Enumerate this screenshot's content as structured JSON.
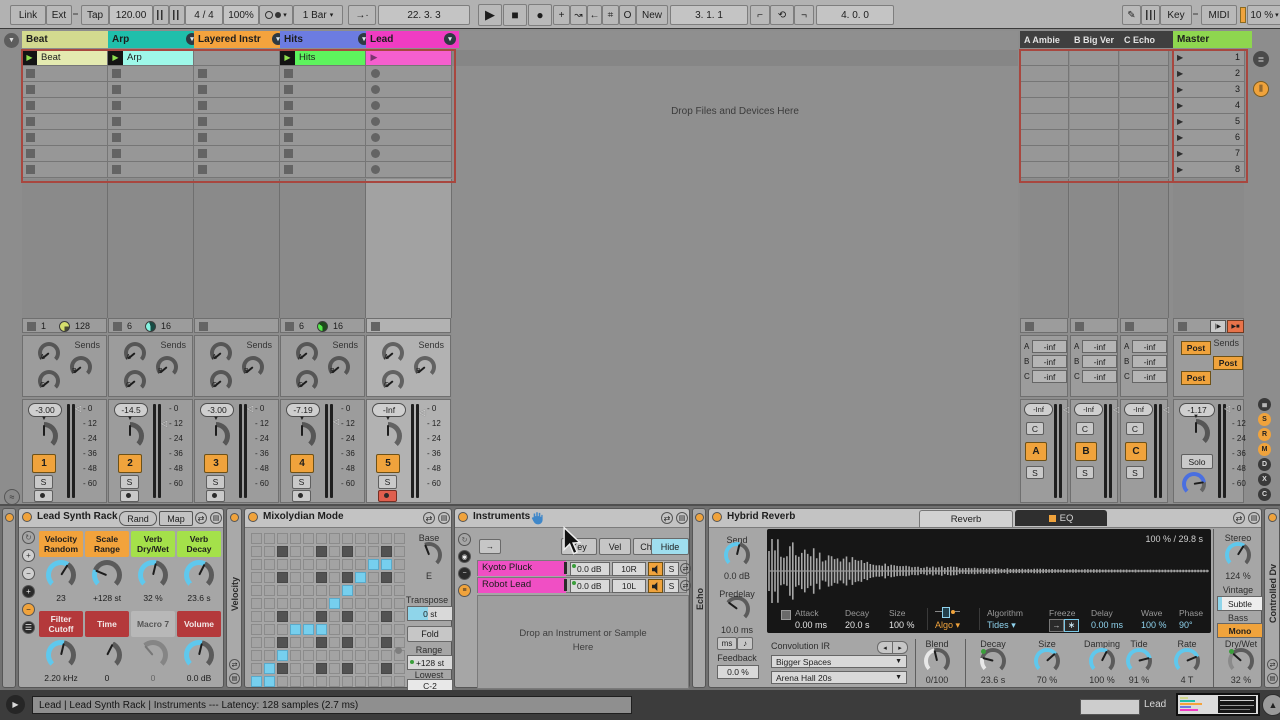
{
  "toolbar": {
    "link": "Link",
    "ext": "Ext",
    "tap": "Tap",
    "tempo": "120.00",
    "sig": "4 / 4",
    "quantize": "100%",
    "groove_menu": "1 Bar",
    "arrangement_pos": "22. 3. 3",
    "new_button": "New",
    "loop_start": "3. 1. 1",
    "loop_length": "4. 0. 0",
    "key": "Key",
    "midi": "MIDI",
    "cpu": "10 %"
  },
  "session": {
    "drop_hint": "Drop Files and Devices Here",
    "scene_numbers": [
      "1",
      "2",
      "3",
      "4",
      "5",
      "6",
      "7",
      "8"
    ],
    "tracks": [
      {
        "name": "Beat",
        "color": "#d3da8f",
        "clip": "Beat",
        "clip_color": "#e4eab0",
        "dd": false,
        "stat1": "1",
        "stat2": "128",
        "pie": [
          "#d6de6d",
          "#4a4a35",
          0.75
        ],
        "vol": "-3.00",
        "num": "1",
        "fader": 0.03,
        "armed": false
      },
      {
        "name": "Arp",
        "color": "#1fbfab",
        "clip": "Arp",
        "clip_color": "#9ef8e9",
        "dd": true,
        "stat1": "6",
        "stat2": "16",
        "pie": [
          "#86f4e2",
          "#174b44",
          0.45
        ],
        "vol": "-14.5",
        "num": "2",
        "fader": 0.2,
        "armed": false
      },
      {
        "name": "Layered Instr",
        "color": "#f4a33d",
        "clip": null,
        "dd": true,
        "stat1": "",
        "stat2": "",
        "pie": null,
        "vol": "-3.00",
        "num": "3",
        "fader": 0.03,
        "armed": false
      },
      {
        "name": "Hits",
        "color": "#6c7ce1",
        "clip": "Hits",
        "clip_color": "#5df35d",
        "dd": true,
        "stat1": "6",
        "stat2": "16",
        "pie": [
          "#54e84a",
          "#1d4b1a",
          0.35
        ],
        "vol": "-7.19",
        "num": "4",
        "fader": 0.18,
        "armed": false
      },
      {
        "name": "Lead",
        "color": "#f03cc3",
        "clip": "",
        "clip_color": "#f55fce",
        "dd": true,
        "stat1": "",
        "stat2": "",
        "pie": null,
        "vol": "-Inf",
        "num": "5",
        "fader": 0.08,
        "armed": true
      }
    ],
    "returns": [
      {
        "name": "A Ambie",
        "vol": "-Inf",
        "letter": "A"
      },
      {
        "name": "B Big Ver",
        "vol": "-Inf",
        "letter": "B"
      },
      {
        "name": "C Echo",
        "vol": "-Inf",
        "letter": "C"
      }
    ],
    "master": {
      "name": "Master",
      "vol": "-1.17",
      "solo": "Solo",
      "post": "Post"
    },
    "sends_label": "Sends",
    "send_letters": [
      "A",
      "B",
      "C"
    ],
    "return_send_value": "-inf",
    "pan_center": "C",
    "db_scale": [
      "0",
      "12",
      "24",
      "36",
      "48",
      "60"
    ],
    "mixer_toggles": [
      "≣",
      "S",
      "R",
      "M",
      "D",
      "X",
      "C"
    ]
  },
  "devices": {
    "rack": {
      "title": "Lead Synth Rack",
      "rand": "Rand",
      "map": "Map",
      "macros": [
        {
          "label": "Velocity Random",
          "hdr": "#f2a33c",
          "light": false,
          "val": "23",
          "fill": 0.62,
          "arc": true,
          "disabled": false
        },
        {
          "label": "Scale Range",
          "hdr": "#f2a33c",
          "light": false,
          "val": "+128 st",
          "fill": 0.25,
          "arc": true,
          "disabled": false
        },
        {
          "label": "Verb Dry/Wet",
          "hdr": "#a4e14a",
          "light": false,
          "val": "32 %",
          "fill": 0.55,
          "arc": true,
          "disabled": false
        },
        {
          "label": "Verb Decay",
          "hdr": "#a4e14a",
          "light": false,
          "val": "23.6 s",
          "fill": 0.6,
          "arc": true,
          "disabled": false
        },
        {
          "label": "Filter Cutoff",
          "hdr": "#b4393b",
          "light": true,
          "val": "2.20 kHz",
          "fill": 0.55,
          "arc": true,
          "disabled": false
        },
        {
          "label": "Time",
          "hdr": "#b4393b",
          "light": true,
          "val": "0",
          "fill": 0.6,
          "arc": false,
          "disabled": false
        },
        {
          "label": "Macro 7",
          "hdr": "",
          "light": false,
          "val": "0",
          "fill": 0.35,
          "arc": false,
          "disabled": true
        },
        {
          "label": "Volume",
          "hdr": "#b4393b",
          "light": true,
          "val": "0.0 dB",
          "fill": 0.55,
          "arc": true,
          "disabled": false
        }
      ]
    },
    "velocity_collapsed": "Velocity",
    "scale": {
      "title": "Mixolydian Mode",
      "base_label": "Base",
      "base_value": "E",
      "transpose_label": "Transpose",
      "transpose_value": "0 st",
      "fold_button": "Fold",
      "range_label": "Range",
      "range_value": "+128 st",
      "lowest_label": "Lowest",
      "lowest_value": "C-2",
      "grid_dark": [
        [
          1,
          2
        ],
        [
          1,
          5
        ],
        [
          1,
          7
        ],
        [
          1,
          10
        ],
        [
          3,
          2
        ],
        [
          3,
          5
        ],
        [
          3,
          7
        ],
        [
          3,
          10
        ],
        [
          6,
          2
        ],
        [
          6,
          5
        ],
        [
          6,
          7
        ],
        [
          6,
          10
        ],
        [
          8,
          2
        ],
        [
          8,
          5
        ],
        [
          8,
          7
        ],
        [
          8,
          10
        ],
        [
          10,
          2
        ],
        [
          10,
          5
        ],
        [
          10,
          7
        ],
        [
          10,
          10
        ]
      ],
      "grid_blue": [
        [
          2,
          9
        ],
        [
          2,
          10
        ],
        [
          3,
          8
        ],
        [
          4,
          7
        ],
        [
          5,
          6
        ],
        [
          7,
          3
        ],
        [
          7,
          4
        ],
        [
          7,
          5
        ],
        [
          9,
          2
        ],
        [
          10,
          1
        ],
        [
          11,
          0
        ],
        [
          11,
          1
        ]
      ]
    },
    "instruments": {
      "title": "Instruments",
      "key": "Key",
      "vel": "Vel",
      "chain": "Chain",
      "hide": "Hide",
      "chains": [
        {
          "name": "Kyoto Pluck",
          "vol": "0.0 dB",
          "pan": "10R",
          "solo": "S"
        },
        {
          "name": "Robot Lead",
          "vol": "0.0 dB",
          "pan": "10L",
          "solo": "S"
        }
      ],
      "drop_hint_1": "Drop an Instrument or Sample",
      "drop_hint_2": "Here"
    },
    "echo_collapsed": "Echo",
    "reverb": {
      "title": "Hybrid Reverb",
      "tab_reverb": "Reverb",
      "tab_eq": "EQ",
      "send_label": "Send",
      "send_value": "0.0 dB",
      "predelay_label": "Predelay",
      "predelay_value": "10.0 ms",
      "ms_button": "ms",
      "feedback_label": "Feedback",
      "feedback_value": "0.0 %",
      "display_readout": "100 % / 29.8 s",
      "attack_label": "Attack",
      "attack_value": "0.00 ms",
      "decay_label": "Decay",
      "decay_value": "20.0 s",
      "size_label": "Size",
      "size_value": "100 %",
      "algo_button": "Algo",
      "algorithm_label": "Algorithm",
      "algorithm_value": "Tides",
      "freeze_label": "Freeze",
      "delay_label": "Delay",
      "delay_value": "0.00 ms",
      "wave_label": "Wave",
      "wave_value": "100 %",
      "phase_label": "Phase",
      "phase_value": "90°",
      "conv_label": "Convolution IR",
      "ir_category": "Bigger Spaces",
      "ir_file": "Arena Hall 20s",
      "knobs": [
        {
          "label": "Blend",
          "val": "0/100",
          "fill": 0.45,
          "style": "light",
          "dot": false
        },
        {
          "label": "Decay",
          "val": "23.6 s",
          "fill": 0.22,
          "style": "light",
          "dot": true
        },
        {
          "label": "Size",
          "val": "70 %",
          "fill": 0.68,
          "style": "cyan",
          "dot": false
        },
        {
          "label": "Damping",
          "val": "100 %",
          "fill": 0.6,
          "style": "cyan",
          "dot": false
        },
        {
          "label": "Tide",
          "val": "91 %",
          "fill": 0.78,
          "style": "cyan",
          "dot": false
        },
        {
          "label": "Rate",
          "val": "4 T",
          "fill": 0.75,
          "style": "cyan",
          "dot": false
        },
        {
          "label": "Dry/Wet",
          "val": "32 %",
          "fill": 0.32,
          "style": "gray",
          "dot": true
        }
      ],
      "stereo_label": "Stereo",
      "stereo_value": "124 %",
      "vintage_label": "Vintage",
      "vintage_value": "Subtle",
      "bass_label": "Bass",
      "bass_value": "Mono"
    },
    "right_collapsed": "Controlled Dv"
  },
  "statusbar": {
    "text": "Lead | Lead Synth Rack | Instruments --- Latency: 128 samples (2.7 ms)",
    "track_label": "Lead"
  }
}
